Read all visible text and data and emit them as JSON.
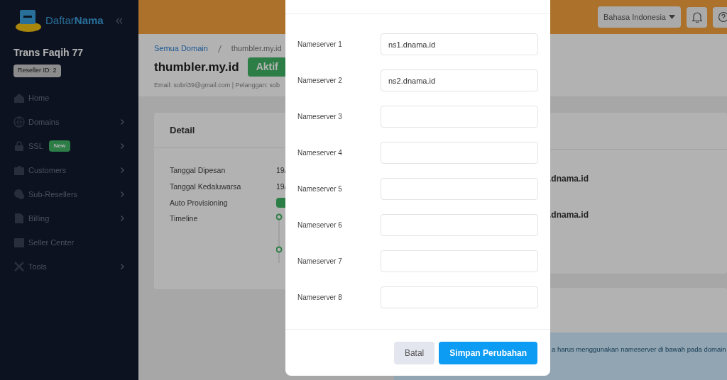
{
  "sidebar": {
    "brand": "Daftar**Nama**",
    "user": "Trans Faqih 77",
    "reseller_id": "Reseller ID: 2",
    "items": [
      {
        "label": "Home",
        "kind": "home",
        "expandable": false
      },
      {
        "label": "Domains",
        "kind": "globe",
        "expandable": true
      },
      {
        "label": "SSL",
        "kind": "lock",
        "expandable": true,
        "badge": "New"
      },
      {
        "label": "Customers",
        "kind": "briefcase",
        "expandable": true
      },
      {
        "label": "Sub-Resellers",
        "kind": "chat",
        "expandable": true
      },
      {
        "label": "Billing",
        "kind": "file",
        "expandable": true
      },
      {
        "label": "Seller Center",
        "kind": "store",
        "expandable": false
      },
      {
        "label": "Tools",
        "kind": "tools",
        "expandable": true
      }
    ]
  },
  "header": {
    "language": "Bahasa Indonesia"
  },
  "page": {
    "breadcrumb": [
      "Semua Domain",
      "thumbler.my.id"
    ],
    "title": "thumbler.my.id",
    "status": "Aktif",
    "meta": "Email: sobri39@gmail.com | Pelanggan: sob"
  },
  "detail_card": {
    "title": "Detail",
    "rows": [
      {
        "kind": "text",
        "label": "Tanggal Dipesan",
        "value": "19/"
      },
      {
        "kind": "text",
        "label": "Tanggal Kedaluwarsa",
        "value": "19/"
      },
      {
        "kind": "badge",
        "label": "Auto Provisioning"
      },
      {
        "kind": "timeline",
        "label": "Timeline"
      }
    ]
  },
  "nameserver_card": {
    "lines": [
      ".dnama.id",
      ".dnama.id"
    ]
  },
  "alert": {
    "text": "a harus menggunakan nameserver di bawah pada domain"
  },
  "modal": {
    "fields": [
      {
        "label": "Nameserver 1",
        "value": "ns1.dnama.id"
      },
      {
        "label": "Nameserver 2",
        "value": "ns2.dnama.id"
      },
      {
        "label": "Nameserver 3"
      },
      {
        "label": "Nameserver 4"
      },
      {
        "label": "Nameserver 5"
      },
      {
        "label": "Nameserver 6"
      },
      {
        "label": "Nameserver 7"
      },
      {
        "label": "Nameserver 8"
      }
    ],
    "cancel": "Batal",
    "save": "Simpan Perubahan"
  }
}
